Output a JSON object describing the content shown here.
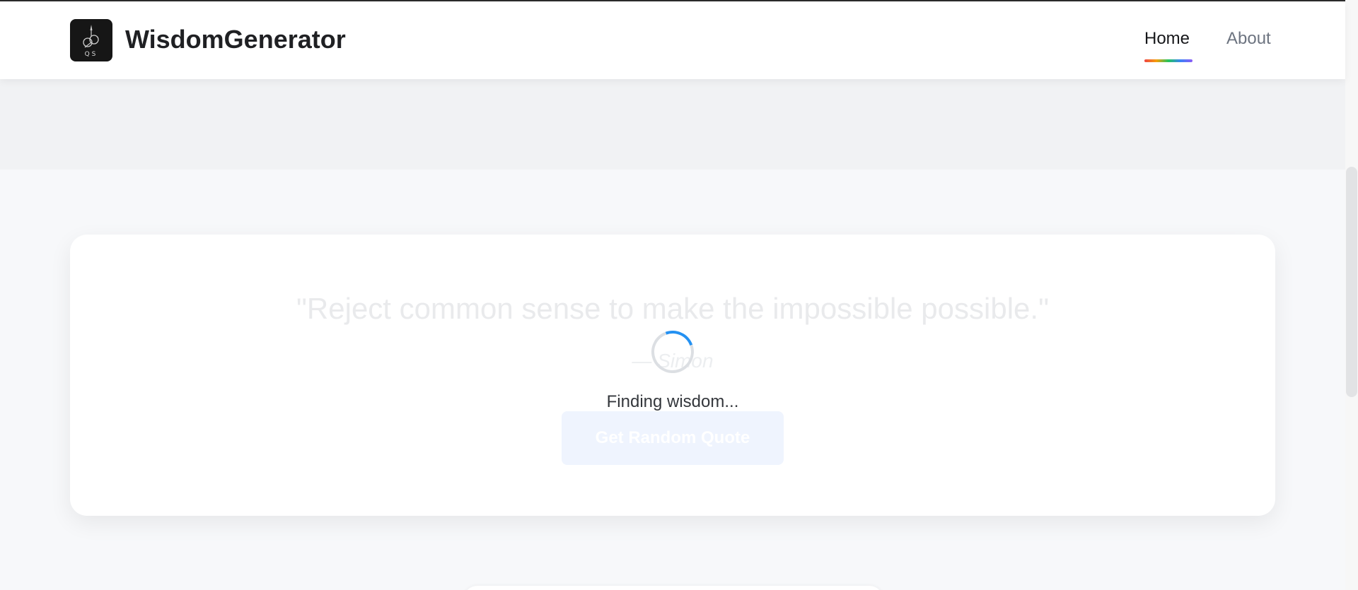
{
  "app": {
    "logo_initials": "QS",
    "brand_name": "WisdomGenerator"
  },
  "nav": {
    "items": [
      {
        "label": "Home",
        "active": true
      },
      {
        "label": "About",
        "active": false
      }
    ]
  },
  "quote_card": {
    "quote": "\"Reject common sense to make the impossible possible.\"",
    "author": "— Simon",
    "loading_text": "Finding wisdom...",
    "button_label": "Get Random Quote",
    "state": "loading"
  },
  "colors": {
    "accent": "#2491f2",
    "nav_active": "#16171a",
    "nav_inactive": "#6d7480",
    "underline_gradient": [
      "#ef4444",
      "#f59e0b",
      "#22c55e",
      "#3b82f6",
      "#8b5cf6"
    ]
  },
  "icons": {
    "logo": "quill-logo-icon",
    "spinner": "loading-spinner-icon"
  }
}
